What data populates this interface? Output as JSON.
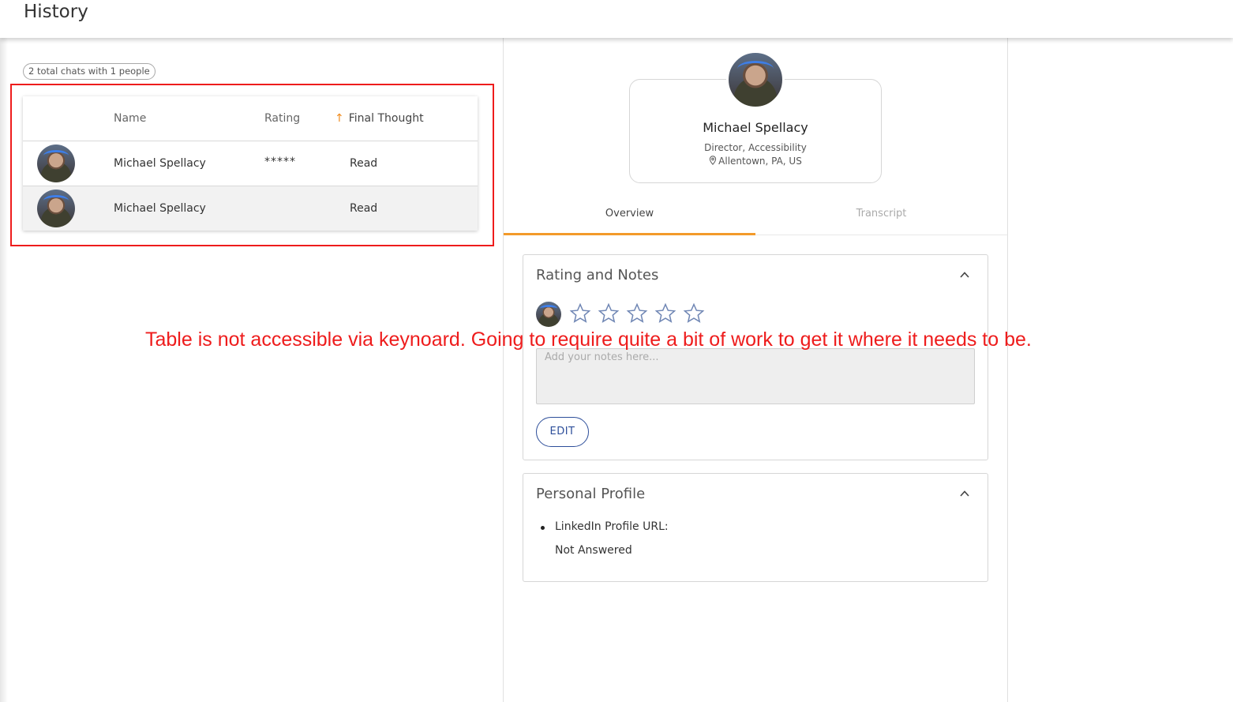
{
  "header": {
    "title": "History"
  },
  "summary": {
    "chip": "2 total chats with 1 people"
  },
  "table": {
    "columns": {
      "name": "Name",
      "rating": "Rating",
      "final_thought": "Final Thought"
    },
    "sort_icon": "arrow-up-icon",
    "rows": [
      {
        "name": "Michael Spellacy",
        "rating": "*****",
        "final_thought": "Read"
      },
      {
        "name": "Michael Spellacy",
        "rating": "",
        "final_thought": "Read"
      }
    ]
  },
  "profile": {
    "name": "Michael Spellacy",
    "title": "Director, Accessibility",
    "location": "Allentown, PA, US"
  },
  "tabs": [
    {
      "label": "Overview",
      "active": true
    },
    {
      "label": "Transcript",
      "active": false
    }
  ],
  "rating_panel": {
    "title": "Rating and Notes",
    "stars_filled": 0,
    "stars_total": 5,
    "notes_placeholder": "Add your notes here...",
    "edit_label": "EDIT"
  },
  "profile_panel": {
    "title": "Personal Profile",
    "items": [
      {
        "label": "LinkedIn Profile URL:",
        "value": "Not Answered"
      }
    ]
  },
  "annotation": "Table is not accessible via keynoard. Going to require quite a bit of work to get it where it needs to be.",
  "colors": {
    "accent": "#f39a2a",
    "annotation": "#ee1c1c",
    "button": "#2d4e9a"
  }
}
